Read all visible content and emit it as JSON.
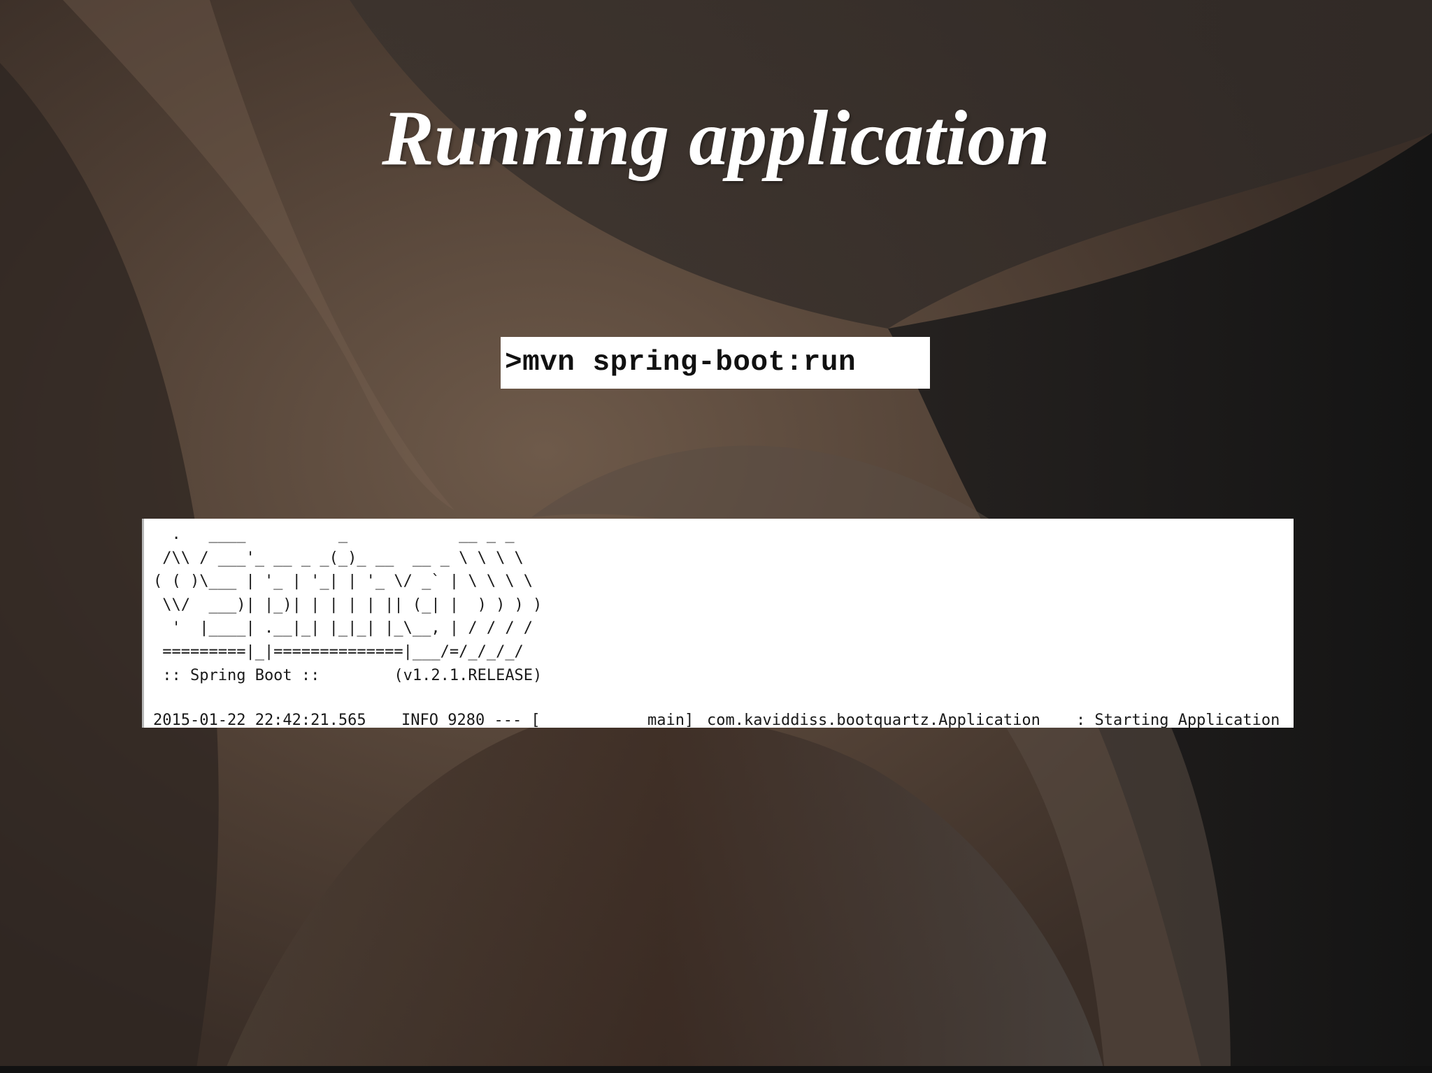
{
  "slide": {
    "title": "Running application"
  },
  "command": {
    "text": ">mvn spring-boot:run"
  },
  "console": {
    "banner": [
      "  .   ____          _            __ _ _",
      " /\\\\ / ___'_ __ _ _(_)_ __  __ _ \\ \\ \\ \\",
      "( ( )\\___ | '_ | '_| | '_ \\/ _` | \\ \\ \\ \\",
      " \\\\/  ___)| |_)| | | | | || (_| |  ) ) ) )",
      "  '  |____| .__|_| |_|_| |_\\__, | / / / /",
      " =========|_|==============|___/=/_/_/_/",
      " :: Spring Boot ::        (v1.2.1.RELEASE)"
    ],
    "log": {
      "timestamp": "2015-01-22 22:42:21.565",
      "level": "INFO 9280 --- [",
      "thread": "main]",
      "logger": "com.kaviddiss.bootquartz.Application",
      "message": ": Starting Application"
    }
  },
  "colors": {
    "background_dark": "#2b2420",
    "background_light": "#6b5646",
    "title": "#ffffff",
    "panel": "#ffffff",
    "console_text": "#1a1a1a"
  }
}
